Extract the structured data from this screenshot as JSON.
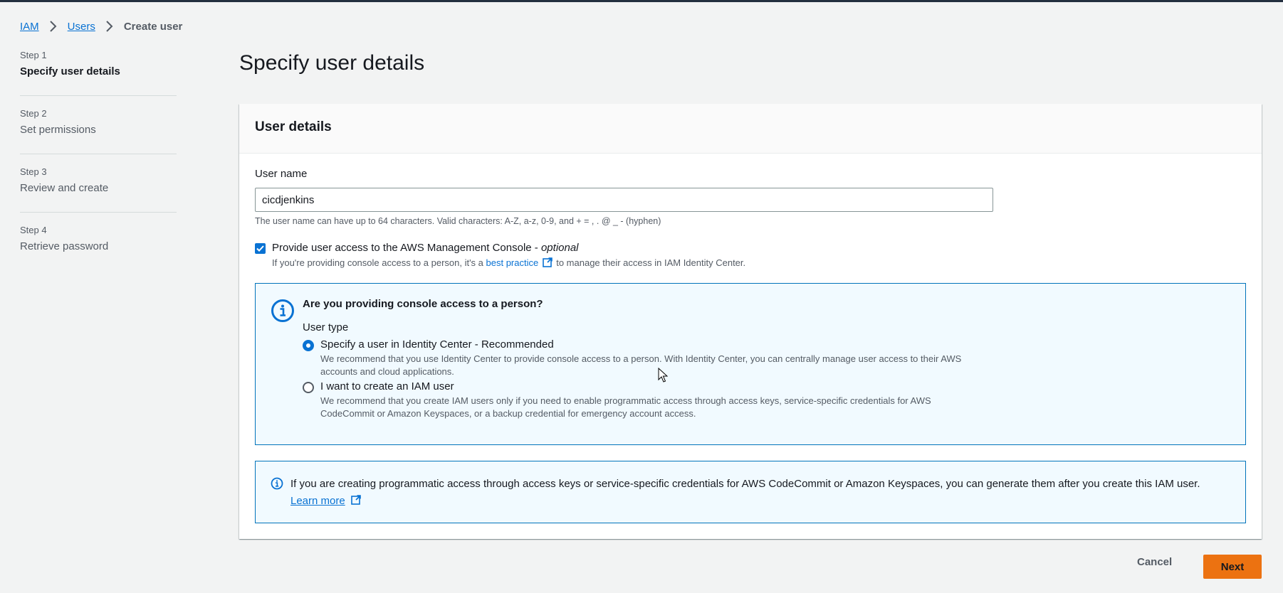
{
  "breadcrumb": {
    "items": [
      "IAM",
      "Users"
    ],
    "current": "Create user"
  },
  "steps": [
    {
      "label": "Step 1",
      "title": "Specify user details",
      "active": true
    },
    {
      "label": "Step 2",
      "title": "Set permissions",
      "active": false
    },
    {
      "label": "Step 3",
      "title": "Review and create",
      "active": false
    },
    {
      "label": "Step 4",
      "title": "Retrieve password",
      "active": false
    }
  ],
  "page": {
    "title": "Specify user details"
  },
  "user_details": {
    "title": "User details",
    "username_label": "User name",
    "username_value": "cicdjenkins",
    "username_constraint": "The user name can have up to 64 characters. Valid characters: A-Z, a-z, 0-9, and + = , . @ _ - (hyphen)",
    "console_checkbox": {
      "checked": true,
      "label": "Provide user access to the AWS Management Console - ",
      "label_optional": "optional",
      "desc_before": "If you're providing console access to a person, it's a ",
      "desc_link": "best practice",
      "desc_after": "to manage their access in IAM Identity Center."
    }
  },
  "console_alert": {
    "heading": "Are you providing console access to a person?",
    "user_type_label": "User type",
    "options": [
      {
        "label": "Specify a user in Identity Center - Recommended",
        "desc": "We recommend that you use Identity Center to provide console access to a person. With Identity Center, you can centrally manage user access to their AWS accounts and cloud applications.",
        "selected": true
      },
      {
        "label": "I want to create an IAM user",
        "desc": "We recommend that you create IAM users only if you need to enable programmatic access through access keys, service-specific credentials for AWS CodeCommit or Amazon Keyspaces, or a backup credential for emergency account access.",
        "selected": false
      }
    ]
  },
  "programmatic_alert": {
    "text": "If you are creating programmatic access through access keys or service-specific credentials for AWS CodeCommit or Amazon Keyspaces, you can generate them after you create this IAM user.",
    "learn_more": "Learn more"
  },
  "footer": {
    "cancel": "Cancel",
    "next": "Next"
  },
  "colors": {
    "accent": "#0972d3",
    "primary_button": "#ec7211",
    "alert_border": "#0073bb",
    "alert_bg": "#f1faff"
  },
  "icons": [
    "chevron-right-icon",
    "external-link-icon",
    "info-icon",
    "checkmark-icon",
    "mouse-cursor-icon"
  ]
}
